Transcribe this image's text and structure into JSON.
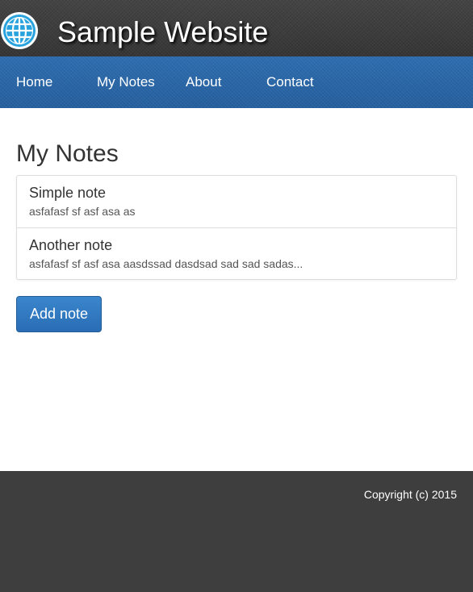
{
  "header": {
    "logo_icon": "globe-icon",
    "title": "Sample Website"
  },
  "nav": {
    "items": [
      {
        "label": "Home"
      },
      {
        "label": "My Notes"
      },
      {
        "label": "About"
      },
      {
        "label": "Contact"
      }
    ]
  },
  "main": {
    "heading": "My Notes",
    "notes": [
      {
        "title": "Simple note",
        "body": "asfafasf sf asf asa as"
      },
      {
        "title": "Another note",
        "body": "asfafasf sf asf asa aasdssad dasdsad sad sad sadas..."
      }
    ],
    "add_button_label": "Add note"
  },
  "footer": {
    "copyright": "Copyright (c) 2015"
  },
  "colors": {
    "header_bg": "#3d3d3d",
    "nav_bg": "#2a66a7",
    "button_bg": "#2a6db5",
    "footer_bg": "#3e3e3e"
  }
}
